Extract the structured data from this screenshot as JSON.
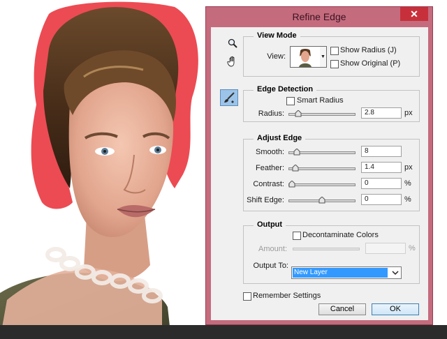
{
  "dialog": {
    "title": "Refine Edge",
    "close_glyph": "✕"
  },
  "tools": [
    {
      "name": "zoom-tool",
      "icon": "magnifier-icon"
    },
    {
      "name": "hand-tool",
      "icon": "hand-icon"
    },
    {
      "name": "refine-radius-tool",
      "icon": "brush-icon",
      "selected": true
    }
  ],
  "view_mode": {
    "title": "View Mode",
    "view_label": "View:",
    "show_radius_label": "Show Radius (J)",
    "show_radius_checked": false,
    "show_original_label": "Show Original (P)",
    "show_original_checked": false
  },
  "edge_detection": {
    "title": "Edge Detection",
    "smart_radius_label": "Smart Radius",
    "smart_radius_checked": false,
    "radius_label": "Radius:",
    "radius_value": "2.8",
    "radius_unit": "px",
    "radius_fraction": 0.11
  },
  "adjust_edge": {
    "title": "Adjust Edge",
    "smooth_label": "Smooth:",
    "smooth_value": "8",
    "smooth_fraction": 0.08,
    "feather_label": "Feather:",
    "feather_value": "1.4",
    "feather_unit": "px",
    "feather_fraction": 0.06,
    "contrast_label": "Contrast:",
    "contrast_value": "0",
    "contrast_unit": "%",
    "contrast_fraction": 0.0,
    "shift_label": "Shift Edge:",
    "shift_value": "0",
    "shift_unit": "%",
    "shift_fraction": 0.5
  },
  "output": {
    "title": "Output",
    "decontaminate_label": "Decontaminate Colors",
    "decontaminate_checked": false,
    "amount_label": "Amount:",
    "amount_unit": "%",
    "output_to_label": "Output To:",
    "output_to_value": "New Layer"
  },
  "remember_settings_label": "Remember Settings",
  "remember_settings_checked": false,
  "buttons": {
    "cancel": "Cancel",
    "ok": "OK"
  },
  "colors": {
    "title_bar": "#c56b7e",
    "close_button": "#c7303a",
    "selection": "#3399ff",
    "overlay_red": "#e8232d"
  }
}
